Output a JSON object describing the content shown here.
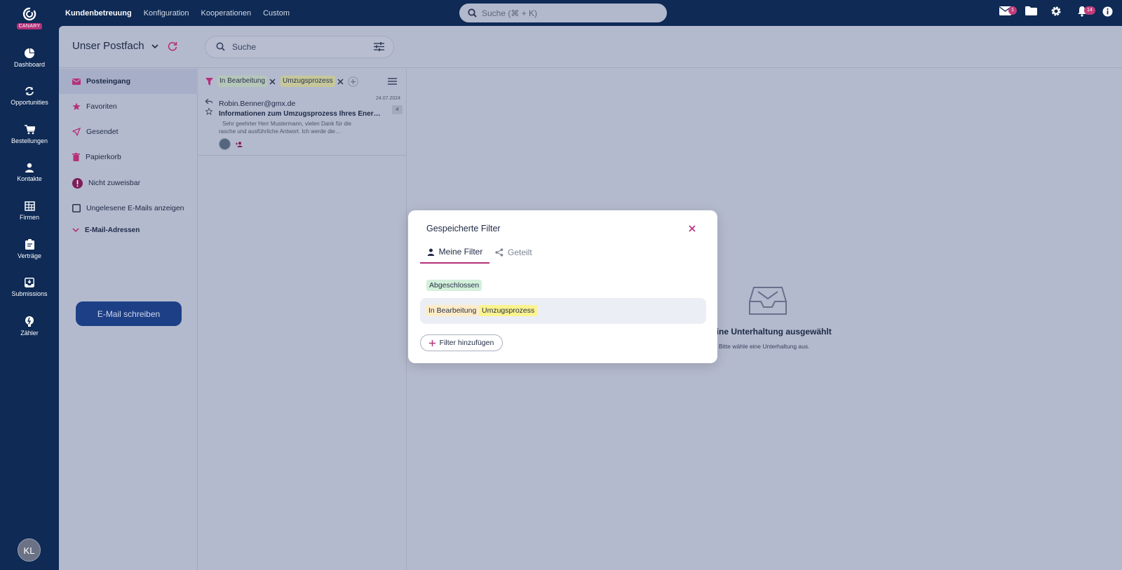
{
  "app": {
    "brand": "CANARY",
    "user_initials": "KL"
  },
  "rail": [
    {
      "label": "Dashboard",
      "icon": "pie-chart-icon"
    },
    {
      "label": "Opportunities",
      "icon": "sync-icon"
    },
    {
      "label": "Bestellungen",
      "icon": "cart-icon"
    },
    {
      "label": "Kontakte",
      "icon": "person-icon"
    },
    {
      "label": "Firmen",
      "icon": "building-icon"
    },
    {
      "label": "Verträge",
      "icon": "clipboard-icon"
    },
    {
      "label": "Submissions",
      "icon": "inbox-download-icon"
    },
    {
      "label": "Zähler",
      "icon": "meter-icon"
    }
  ],
  "topnav": [
    "Kundenbetreuung",
    "Konfiguration",
    "Kooperationen",
    "Custom"
  ],
  "global_search": {
    "placeholder": "Suche (⌘ + K)"
  },
  "top_icons": {
    "mail_badge": "1",
    "notifications_badge": "14"
  },
  "mailbox": {
    "title": "Unser Postfach",
    "search_placeholder": "Suche"
  },
  "sidebar": {
    "items": [
      {
        "label": "Posteingang",
        "icon": "mail-icon"
      },
      {
        "label": "Favoriten",
        "icon": "star-icon"
      },
      {
        "label": "Gesendet",
        "icon": "send-icon"
      },
      {
        "label": "Papierkorb",
        "icon": "trash-icon"
      },
      {
        "label": "Nicht zuweisbar",
        "icon": "alert-icon"
      },
      {
        "label": "Ungelesene E-Mails anzeigen",
        "icon": "checkbox-icon"
      },
      {
        "label": "E-Mail-Adressen",
        "icon": "chevron-down-icon"
      }
    ],
    "compose_label": "E-Mail schreiben"
  },
  "filter_bar": {
    "chips": [
      "In Bearbeitung",
      "Umzugsprozess"
    ]
  },
  "mail_item": {
    "date": "24.07.2024",
    "from": "Robin.Benner@gmx.de",
    "subject": "Informationen zum Umzugsprozess Ihres Ener…",
    "preview_1": "Sehr geehrter Herr Mustermann, vielen Dank für die",
    "preview_2": "rasche und ausführliche Antwort. Ich werde die…",
    "count": "4"
  },
  "empty_state": {
    "title": "eine Unterhaltung ausgewählt",
    "subtitle": "Bitte wähle eine Unterhaltung aus."
  },
  "modal": {
    "title": "Gespeicherte Filter",
    "tabs": {
      "mine": "Meine Filter",
      "shared": "Geteilt"
    },
    "filters": [
      {
        "tags": [
          "Abgeschlossen"
        ]
      },
      {
        "tags": [
          "In Bearbeitung",
          "Umzugsprozess"
        ]
      }
    ],
    "add_label": "Filter hinzufügen"
  },
  "colors": {
    "rail": "#0e2a55",
    "accent": "#b5307a",
    "tag_green": "#d3f0da",
    "tag_yellow": "#fbf38e",
    "tag_orange": "#fdecc8"
  }
}
